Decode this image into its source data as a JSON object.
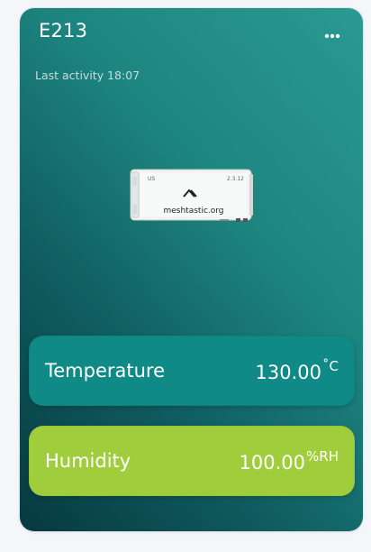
{
  "device": {
    "name": "E213",
    "last_activity_label": "Last activity 18:07",
    "image_caption": "meshtastic.org",
    "screen_region": "US",
    "screen_version": "2.3.12"
  },
  "menu": {
    "icon": "more-horizontal-icon"
  },
  "sensors": [
    {
      "label": "Temperature",
      "value": "130.00",
      "unit": "˚C",
      "color": "#0f8a86"
    },
    {
      "label": "Humidity",
      "value": "100.00",
      "unit": "%RH",
      "color": "#a0cd3c"
    }
  ],
  "colors": {
    "card_gradient_start": "#063a3f",
    "card_gradient_end": "#2a9a92",
    "page_background": "#f5f6fa"
  }
}
